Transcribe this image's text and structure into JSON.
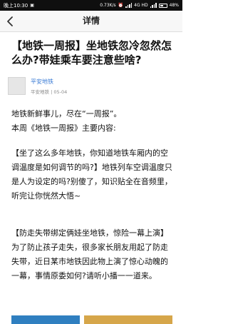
{
  "status_bar": {
    "time": "晚上10:30",
    "speed": "0.73K/s",
    "network": "4G HD",
    "battery": "48%"
  },
  "nav": {
    "title": "详情",
    "back_icon": "back-arrow-icon"
  },
  "article": {
    "title": "【地铁一周报】坐地铁忽冷忽然怎么办?带娃乘车要注意些啥?",
    "author": "平安地铁",
    "meta": "平安地铁 | 05-04",
    "intro": [
      "地铁新鲜事儿，尽在“一周报”。",
      "本周《地铁一周报》主要内容:"
    ],
    "section1": "【坐了这么多年地铁，你知道地铁车厢内的空调温度是如何调节的吗?】地铁列车空调温度只是人为设定的吗?别傻了，知识贴全在音频里，听完让你恍然大悟~",
    "section2": "【防走失带绑定俩娃坐地铁，惊险一幕上演】为了防止孩子走失，很多家长朋友用起了防走失带，近日某市地铁因此物上演了惊心动魄的一幕，事情原委如何?请听小播一一道来。"
  }
}
